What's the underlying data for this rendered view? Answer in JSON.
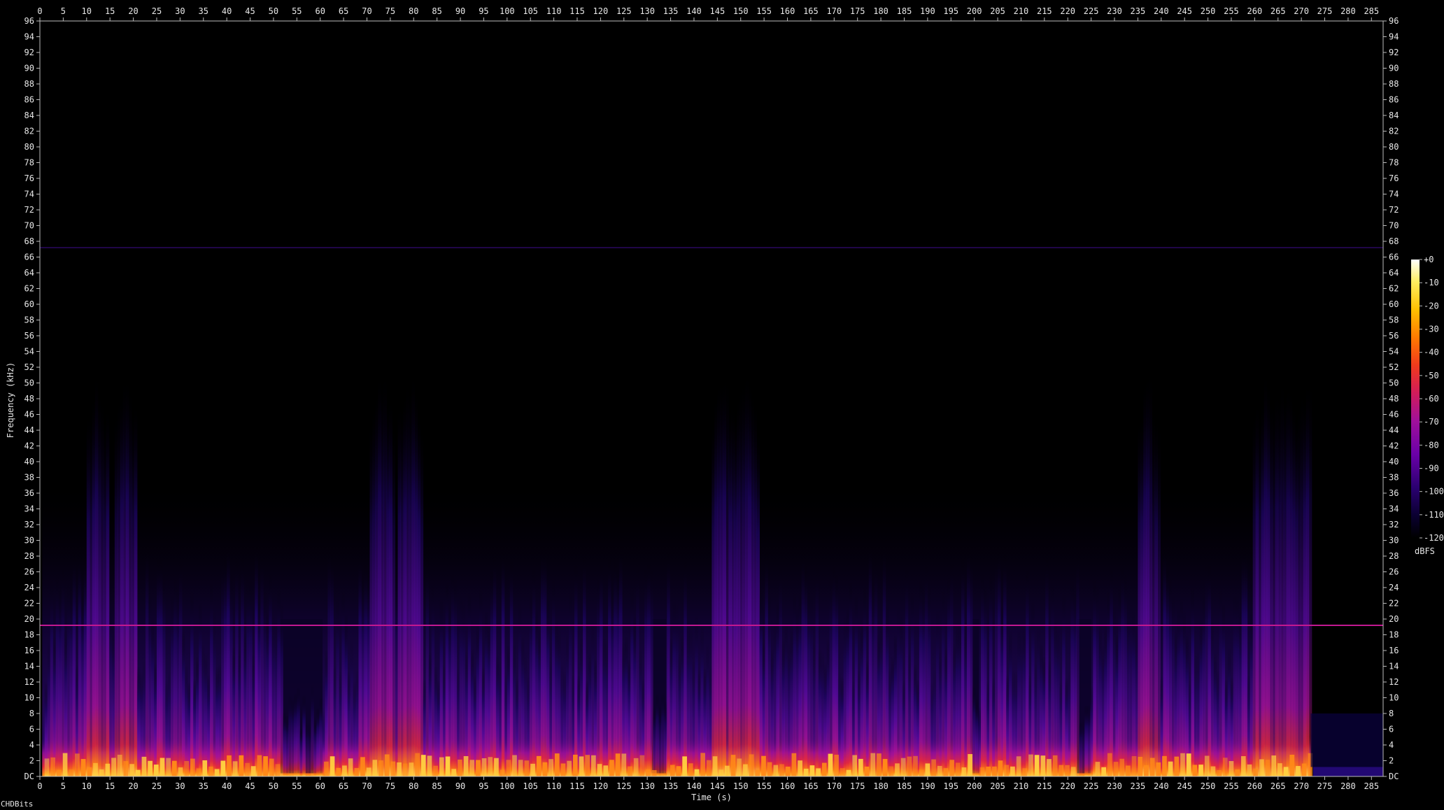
{
  "chart_data": {
    "type": "heatmap",
    "xlabel": "Time (s)",
    "ylabel": "Frequency (kHz)",
    "xlim": [
      0,
      287.5
    ],
    "ylim": [
      0,
      96
    ],
    "x_ticks": [
      0,
      5,
      10,
      15,
      20,
      25,
      30,
      35,
      40,
      45,
      50,
      55,
      60,
      65,
      70,
      75,
      80,
      85,
      90,
      95,
      100,
      105,
      110,
      115,
      120,
      125,
      130,
      135,
      140,
      145,
      150,
      155,
      160,
      165,
      170,
      175,
      180,
      185,
      190,
      195,
      200,
      205,
      210,
      215,
      220,
      225,
      230,
      235,
      240,
      245,
      250,
      255,
      260,
      265,
      270,
      275,
      280,
      285
    ],
    "y_ticks": [
      "DC",
      "2",
      "4",
      "6",
      "8",
      "10",
      "12",
      "14",
      "16",
      "18",
      "20",
      "22",
      "24",
      "26",
      "28",
      "30",
      "32",
      "34",
      "36",
      "38",
      "40",
      "42",
      "44",
      "46",
      "48",
      "50",
      "52",
      "54",
      "56",
      "58",
      "60",
      "62",
      "64",
      "66",
      "68",
      "70",
      "72",
      "74",
      "76",
      "78",
      "80",
      "82",
      "84",
      "86",
      "88",
      "90",
      "92",
      "94",
      "96"
    ],
    "colorbar": {
      "label": "dBFS",
      "ticks": [
        "+0",
        "-10",
        "-20",
        "-30",
        "-40",
        "-50",
        "-60",
        "-70",
        "-80",
        "-90",
        "-100",
        "-110",
        "-120"
      ],
      "range": [
        -120,
        0
      ],
      "colors": [
        "#000000",
        "#0a0030",
        "#2a0070",
        "#6a00a8",
        "#a0109a",
        "#d01c5a",
        "#f03a1c",
        "#ff7a00",
        "#ffc000",
        "#ffee60",
        "#ffffff"
      ]
    },
    "horizontal_lines_khz": [
      19.2,
      67.2
    ],
    "loud_peaks_s": [
      12,
      18,
      73,
      79,
      146,
      151,
      237,
      262,
      266,
      271
    ]
  },
  "footer": {
    "label": "CHDBits"
  }
}
